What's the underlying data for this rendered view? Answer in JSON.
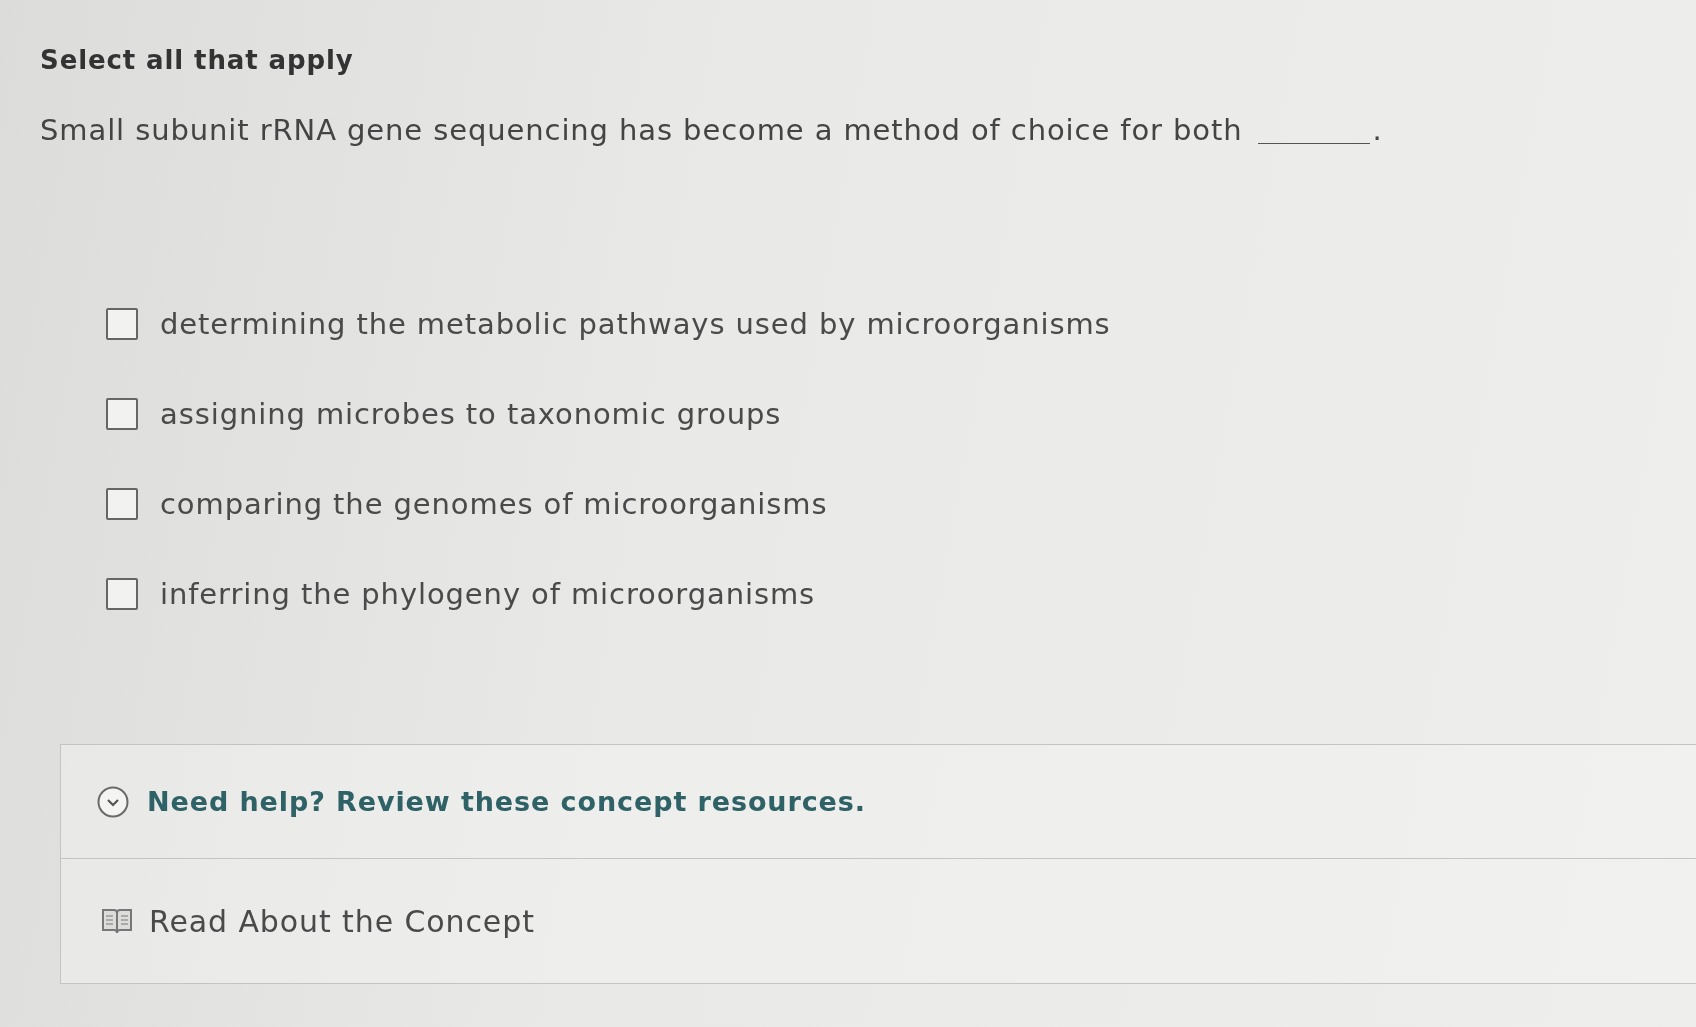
{
  "instruction": "Select all that apply",
  "question": {
    "text": "Small subunit rRNA gene sequencing has become a method of choice for both",
    "end_mark": "."
  },
  "options": [
    {
      "label": "determining the metabolic pathways used by microorganisms",
      "checked": false
    },
    {
      "label": "assigning microbes to taxonomic groups",
      "checked": false
    },
    {
      "label": "comparing the genomes of microorganisms",
      "checked": false
    },
    {
      "label": "inferring the phylogeny of microorganisms",
      "checked": false
    }
  ],
  "help": {
    "title": "Need help? Review these concept resources.",
    "expanded": true,
    "resources": [
      {
        "label": "Read About the Concept"
      }
    ]
  }
}
